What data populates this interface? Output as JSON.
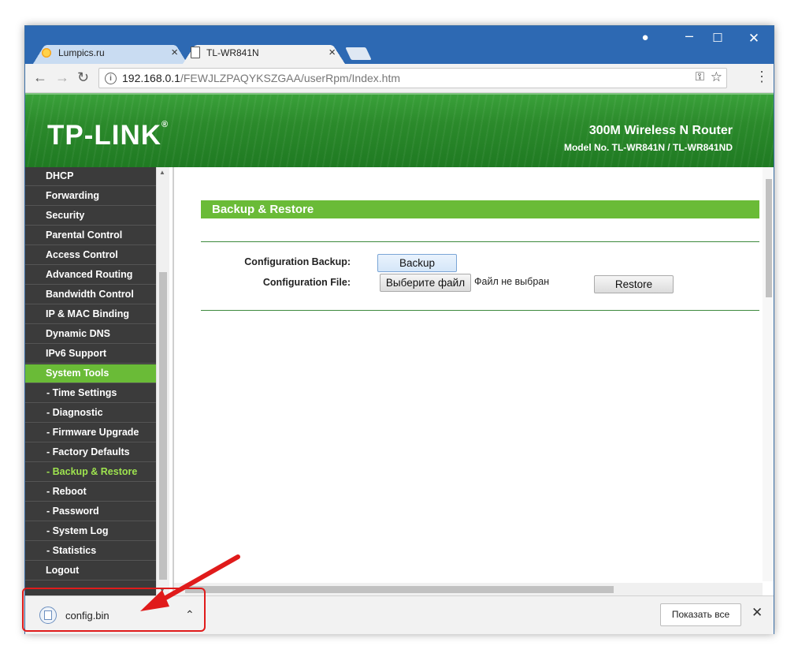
{
  "browser": {
    "tabs": [
      {
        "title": "Lumpics.ru",
        "close": "×"
      },
      {
        "title": "TL-WR841N",
        "close": "×"
      }
    ],
    "window_controls": {
      "user": "●",
      "minimize": "–",
      "maximize": "☐",
      "close": "✕"
    },
    "url_host": "192.168.0.1",
    "url_path": "/FEWJLZPAQYKSZGAA/userRpm/Index.htm",
    "info_icon": "i"
  },
  "router": {
    "logo": "TP-LINK",
    "product_name": "300M Wireless N Router",
    "model": "Model No. TL-WR841N / TL-WR841ND"
  },
  "sidebar": {
    "items": [
      {
        "label": "DHCP",
        "state": "normal"
      },
      {
        "label": "Forwarding",
        "state": "normal"
      },
      {
        "label": "Security",
        "state": "normal"
      },
      {
        "label": "Parental Control",
        "state": "normal"
      },
      {
        "label": "Access Control",
        "state": "normal"
      },
      {
        "label": "Advanced Routing",
        "state": "normal"
      },
      {
        "label": "Bandwidth Control",
        "state": "normal"
      },
      {
        "label": "IP & MAC Binding",
        "state": "normal"
      },
      {
        "label": "Dynamic DNS",
        "state": "normal"
      },
      {
        "label": "IPv6 Support",
        "state": "normal"
      },
      {
        "label": "System Tools",
        "state": "active"
      },
      {
        "label": "- Time Settings",
        "state": "sub"
      },
      {
        "label": "- Diagnostic",
        "state": "sub"
      },
      {
        "label": "- Firmware Upgrade",
        "state": "sub"
      },
      {
        "label": "- Factory Defaults",
        "state": "sub"
      },
      {
        "label": "- Backup & Restore",
        "state": "current"
      },
      {
        "label": "- Reboot",
        "state": "sub"
      },
      {
        "label": "- Password",
        "state": "sub"
      },
      {
        "label": "- System Log",
        "state": "sub"
      },
      {
        "label": "- Statistics",
        "state": "sub"
      },
      {
        "label": "Logout",
        "state": "normal"
      }
    ]
  },
  "main": {
    "section_title": "Backup & Restore",
    "config_backup_label": "Configuration Backup:",
    "backup_button": "Backup",
    "config_file_label": "Configuration File:",
    "choose_file_button": "Выберите файл",
    "file_status": "Файл не выбран",
    "restore_button": "Restore"
  },
  "downloads": {
    "file_name": "config.bin",
    "show_all": "Показать все"
  },
  "colors": {
    "accent_green": "#6abb37",
    "chrome_blue": "#2d69b3",
    "highlight_red": "#e01b1b"
  }
}
